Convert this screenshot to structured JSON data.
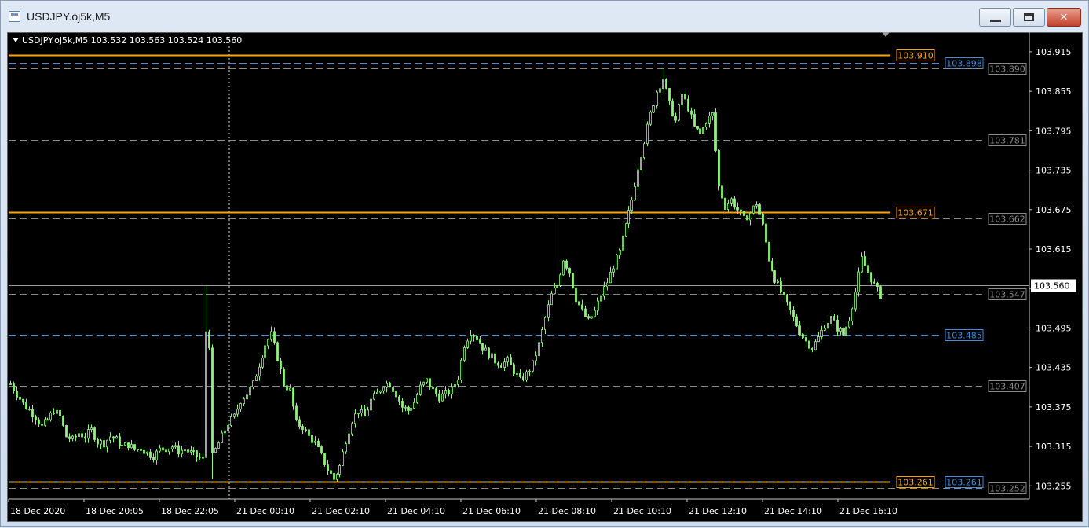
{
  "window": {
    "title": "USDJPY.oj5k,M5",
    "buttons": {
      "minimize": "minimize-icon",
      "maximize": "maximize-icon",
      "close": "close-icon"
    }
  },
  "chart": {
    "info": "USDJPY.oj5k,M5  103.532 103.563 103.524 103.560",
    "current_price": "103.560",
    "colors": {
      "background": "#000000",
      "candle": "#8ff27a",
      "orange_line": "#ffa500",
      "blue_line": "#3d8de0",
      "gray_line": "#8a8a8a",
      "bid_line": "#9a9a9a"
    }
  },
  "chart_data": {
    "type": "candlestick",
    "symbol": "USDJPY.oj5k",
    "timeframe": "M5",
    "ohlc": {
      "open": 103.532,
      "high": 103.563,
      "low": 103.524,
      "close": 103.56
    },
    "ylim": [
      103.235,
      103.94
    ],
    "y_ticks": [
      "103.915",
      "103.855",
      "103.795",
      "103.735",
      "103.675",
      "103.615",
      "103.555",
      "103.495",
      "103.435",
      "103.375",
      "103.315",
      "103.255"
    ],
    "x_ticks": [
      "18 Dec 2020",
      "18 Dec 20:05",
      "18 Dec 22:05",
      "21 Dec 00:10",
      "21 Dec 02:10",
      "21 Dec 04:10",
      "21 Dec 06:10",
      "21 Dec 08:10",
      "21 Dec 10:10",
      "21 Dec 12:10",
      "21 Dec 14:10",
      "21 Dec 16:10"
    ],
    "levels": [
      {
        "price": 103.91,
        "label": "103.910",
        "kind": "orange"
      },
      {
        "price": 103.898,
        "label": "103.898",
        "kind": "blue"
      },
      {
        "price": 103.89,
        "label": "103.890",
        "kind": "gray"
      },
      {
        "price": 103.781,
        "label": "103.781",
        "kind": "gray"
      },
      {
        "price": 103.671,
        "label": "103.671",
        "kind": "orange"
      },
      {
        "price": 103.662,
        "label": "103.662",
        "kind": "gray"
      },
      {
        "price": 103.547,
        "label": "103.547",
        "kind": "gray"
      },
      {
        "price": 103.485,
        "label": "103.485",
        "kind": "blue"
      },
      {
        "price": 103.407,
        "label": "103.407",
        "kind": "gray"
      },
      {
        "price": 103.261,
        "label": "103.261",
        "kind": "orange"
      },
      {
        "price": 103.261,
        "label": "103.261",
        "kind": "blue"
      },
      {
        "price": 103.252,
        "label": "103.252",
        "kind": "gray"
      }
    ],
    "session_separator": "21 Dec 00:10",
    "price_path": [
      [
        0,
        103.41
      ],
      [
        2,
        103.395
      ],
      [
        4,
        103.38
      ],
      [
        6,
        103.37
      ],
      [
        8,
        103.36
      ],
      [
        10,
        103.345
      ],
      [
        12,
        103.355
      ],
      [
        14,
        103.37
      ],
      [
        16,
        103.36
      ],
      [
        18,
        103.33
      ],
      [
        20,
        103.325
      ],
      [
        22,
        103.335
      ],
      [
        24,
        103.33
      ],
      [
        26,
        103.34
      ],
      [
        28,
        103.322
      ],
      [
        30,
        103.32
      ],
      [
        32,
        103.33
      ],
      [
        34,
        103.325
      ],
      [
        36,
        103.315
      ],
      [
        38,
        103.318
      ],
      [
        40,
        103.31
      ],
      [
        42,
        103.312
      ],
      [
        44,
        103.305
      ],
      [
        46,
        103.3
      ],
      [
        48,
        103.31
      ],
      [
        50,
        103.312
      ],
      [
        52,
        103.315
      ],
      [
        54,
        103.308
      ],
      [
        56,
        103.31
      ],
      [
        58,
        103.305
      ],
      [
        60,
        103.3
      ],
      [
        62,
        103.295
      ],
      [
        63,
        103.49
      ],
      [
        64,
        103.47
      ],
      [
        65,
        103.3
      ],
      [
        66,
        103.31
      ],
      [
        68,
        103.33
      ],
      [
        70,
        103.35
      ],
      [
        72,
        103.36
      ],
      [
        74,
        103.385
      ],
      [
        76,
        103.395
      ],
      [
        78,
        103.41
      ],
      [
        80,
        103.44
      ],
      [
        82,
        103.47
      ],
      [
        84,
        103.485
      ],
      [
        86,
        103.45
      ],
      [
        88,
        103.41
      ],
      [
        90,
        103.4
      ],
      [
        92,
        103.35
      ],
      [
        94,
        103.345
      ],
      [
        96,
        103.33
      ],
      [
        98,
        103.32
      ],
      [
        100,
        103.3
      ],
      [
        102,
        103.28
      ],
      [
        104,
        103.265
      ],
      [
        106,
        103.285
      ],
      [
        108,
        103.325
      ],
      [
        110,
        103.355
      ],
      [
        112,
        103.37
      ],
      [
        114,
        103.36
      ],
      [
        116,
        103.385
      ],
      [
        118,
        103.395
      ],
      [
        120,
        103.41
      ],
      [
        122,
        103.41
      ],
      [
        124,
        103.395
      ],
      [
        126,
        103.375
      ],
      [
        128,
        103.37
      ],
      [
        130,
        103.382
      ],
      [
        132,
        103.405
      ],
      [
        134,
        103.415
      ],
      [
        136,
        103.4
      ],
      [
        138,
        103.39
      ],
      [
        140,
        103.395
      ],
      [
        142,
        103.4
      ],
      [
        144,
        103.42
      ],
      [
        146,
        103.47
      ],
      [
        148,
        103.49
      ],
      [
        150,
        103.48
      ],
      [
        152,
        103.465
      ],
      [
        154,
        103.455
      ],
      [
        156,
        103.445
      ],
      [
        158,
        103.44
      ],
      [
        160,
        103.445
      ],
      [
        162,
        103.43
      ],
      [
        164,
        103.415
      ],
      [
        166,
        103.425
      ],
      [
        168,
        103.44
      ],
      [
        170,
        103.47
      ],
      [
        172,
        103.51
      ],
      [
        174,
        103.545
      ],
      [
        176,
        103.56
      ],
      [
        178,
        103.6
      ],
      [
        180,
        103.58
      ],
      [
        182,
        103.54
      ],
      [
        184,
        103.52
      ],
      [
        186,
        103.505
      ],
      [
        188,
        103.52
      ],
      [
        190,
        103.545
      ],
      [
        192,
        103.565
      ],
      [
        194,
        103.59
      ],
      [
        196,
        103.61
      ],
      [
        198,
        103.65
      ],
      [
        200,
        103.69
      ],
      [
        202,
        103.74
      ],
      [
        204,
        103.78
      ],
      [
        206,
        103.82
      ],
      [
        208,
        103.855
      ],
      [
        210,
        103.875
      ],
      [
        212,
        103.835
      ],
      [
        214,
        103.81
      ],
      [
        216,
        103.85
      ],
      [
        218,
        103.83
      ],
      [
        220,
        103.8
      ],
      [
        222,
        103.79
      ],
      [
        224,
        103.81
      ],
      [
        226,
        103.82
      ],
      [
        228,
        103.71
      ],
      [
        230,
        103.68
      ],
      [
        232,
        103.69
      ],
      [
        234,
        103.675
      ],
      [
        236,
        103.66
      ],
      [
        238,
        103.67
      ],
      [
        240,
        103.685
      ],
      [
        242,
        103.65
      ],
      [
        244,
        103.6
      ],
      [
        246,
        103.57
      ],
      [
        248,
        103.55
      ],
      [
        250,
        103.53
      ],
      [
        252,
        103.51
      ],
      [
        254,
        103.49
      ],
      [
        256,
        103.475
      ],
      [
        258,
        103.465
      ],
      [
        260,
        103.48
      ],
      [
        262,
        103.5
      ],
      [
        264,
        103.51
      ],
      [
        266,
        103.495
      ],
      [
        268,
        103.485
      ],
      [
        270,
        103.51
      ],
      [
        272,
        103.55
      ],
      [
        274,
        103.6
      ],
      [
        276,
        103.58
      ],
      [
        278,
        103.56
      ],
      [
        280,
        103.545
      ]
    ]
  }
}
